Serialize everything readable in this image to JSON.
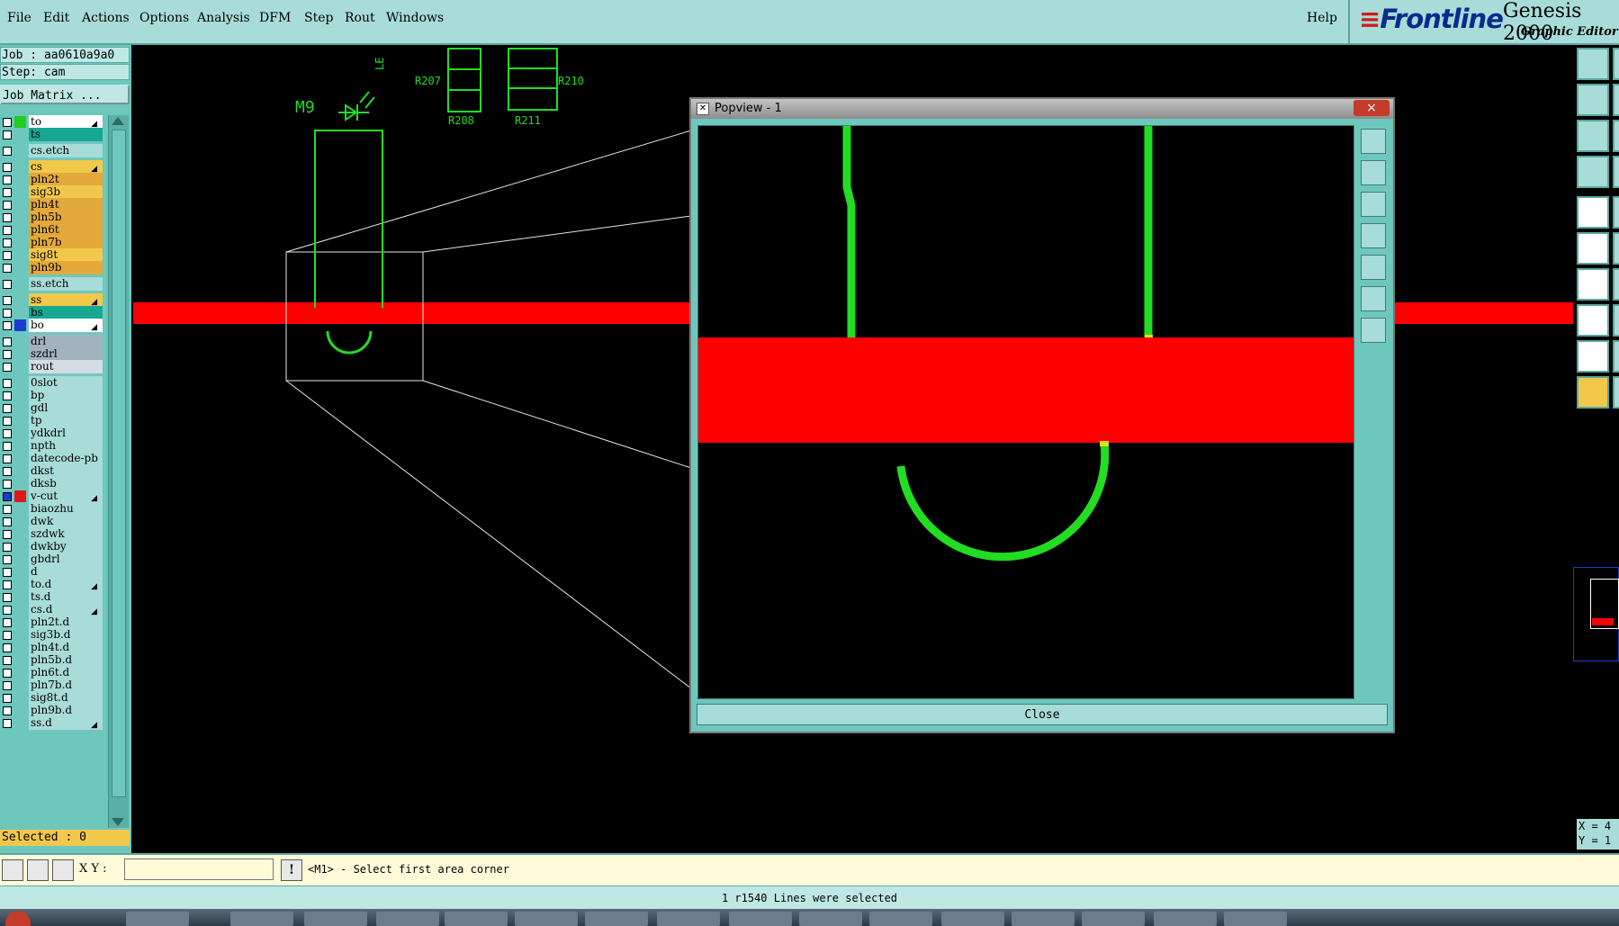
{
  "menu": {
    "items": [
      "File",
      "Edit",
      "Actions",
      "Options",
      "Analysis",
      "DFM",
      "Step",
      "Rout",
      "Windows"
    ],
    "help": "Help"
  },
  "brand": {
    "logo": "Frontline",
    "product": "Genesis 2000",
    "subtitle": "Graphic Editor"
  },
  "job": {
    "job_line": "Job : aa0610a9a0",
    "step_line": "Step: cam",
    "matrix_button": "Job Matrix ..."
  },
  "layers": [
    {
      "name": "to",
      "bg": "#ffffff",
      "swatch": "#22cc22",
      "arrow": true
    },
    {
      "name": "ts",
      "bg": "#16a892",
      "swatch": "",
      "arrow": false
    },
    {
      "name": "cs.etch",
      "bg": "#a8dcd8",
      "swatch": "",
      "arrow": false
    },
    {
      "name": "cs",
      "bg": "#f2c84a",
      "swatch": "",
      "arrow": true
    },
    {
      "name": "pln2t",
      "bg": "#e3a93a",
      "swatch": "",
      "arrow": false
    },
    {
      "name": "sig3b",
      "bg": "#f2c84a",
      "swatch": "",
      "arrow": false
    },
    {
      "name": "pln4t",
      "bg": "#e3a93a",
      "swatch": "",
      "arrow": false
    },
    {
      "name": "pln5b",
      "bg": "#e3a93a",
      "swatch": "",
      "arrow": false
    },
    {
      "name": "pln6t",
      "bg": "#e3a93a",
      "swatch": "",
      "arrow": false
    },
    {
      "name": "pln7b",
      "bg": "#e3a93a",
      "swatch": "",
      "arrow": false
    },
    {
      "name": "sig8t",
      "bg": "#f2c84a",
      "swatch": "",
      "arrow": false
    },
    {
      "name": "pln9b",
      "bg": "#e3a93a",
      "swatch": "",
      "arrow": false
    },
    {
      "name": "ss.etch",
      "bg": "#a8dcd8",
      "swatch": "",
      "arrow": false
    },
    {
      "name": "ss",
      "bg": "#f2c84a",
      "swatch": "",
      "arrow": true
    },
    {
      "name": "bs",
      "bg": "#16a892",
      "swatch": "",
      "arrow": false
    },
    {
      "name": "bo",
      "bg": "#ffffff",
      "swatch": "#1a3ccf",
      "arrow": true
    },
    {
      "name": "drl",
      "bg": "#a3b3bd",
      "swatch": "",
      "arrow": false
    },
    {
      "name": "szdrl",
      "bg": "#a3b3bd",
      "swatch": "",
      "arrow": false
    },
    {
      "name": "rout",
      "bg": "#d6dde2",
      "swatch": "",
      "arrow": false
    },
    {
      "name": "0slot",
      "bg": "#a8dcd8",
      "swatch": "",
      "arrow": false
    },
    {
      "name": "bp",
      "bg": "#a8dcd8",
      "swatch": "",
      "arrow": false
    },
    {
      "name": "gdl",
      "bg": "#a8dcd8",
      "swatch": "",
      "arrow": false
    },
    {
      "name": "tp",
      "bg": "#a8dcd8",
      "swatch": "",
      "arrow": false
    },
    {
      "name": "ydkdrl",
      "bg": "#a8dcd8",
      "swatch": "",
      "arrow": false
    },
    {
      "name": "npth",
      "bg": "#a8dcd8",
      "swatch": "",
      "arrow": false
    },
    {
      "name": "datecode-pb",
      "bg": "#a8dcd8",
      "swatch": "",
      "arrow": false
    },
    {
      "name": "dkst",
      "bg": "#a8dcd8",
      "swatch": "",
      "arrow": false
    },
    {
      "name": "dksb",
      "bg": "#a8dcd8",
      "swatch": "",
      "arrow": false
    },
    {
      "name": "v-cut",
      "bg": "#a8dcd8",
      "swatch": "#e01818",
      "arrow": true,
      "active": true
    },
    {
      "name": "biaozhu",
      "bg": "#a8dcd8",
      "swatch": "",
      "arrow": false
    },
    {
      "name": "dwk",
      "bg": "#a8dcd8",
      "swatch": "",
      "arrow": false
    },
    {
      "name": "szdwk",
      "bg": "#a8dcd8",
      "swatch": "",
      "arrow": false
    },
    {
      "name": "dwkby",
      "bg": "#a8dcd8",
      "swatch": "",
      "arrow": false
    },
    {
      "name": "gbdrl",
      "bg": "#a8dcd8",
      "swatch": "",
      "arrow": false
    },
    {
      "name": "d",
      "bg": "#a8dcd8",
      "swatch": "",
      "arrow": false
    },
    {
      "name": "to.d",
      "bg": "#a8dcd8",
      "swatch": "",
      "arrow": true
    },
    {
      "name": "ts.d",
      "bg": "#a8dcd8",
      "swatch": "",
      "arrow": false
    },
    {
      "name": "cs.d",
      "bg": "#a8dcd8",
      "swatch": "",
      "arrow": true
    },
    {
      "name": "pln2t.d",
      "bg": "#a8dcd8",
      "swatch": "",
      "arrow": false
    },
    {
      "name": "sig3b.d",
      "bg": "#a8dcd8",
      "swatch": "",
      "arrow": false
    },
    {
      "name": "pln4t.d",
      "bg": "#a8dcd8",
      "swatch": "",
      "arrow": false
    },
    {
      "name": "pln5b.d",
      "bg": "#a8dcd8",
      "swatch": "",
      "arrow": false
    },
    {
      "name": "pln6t.d",
      "bg": "#a8dcd8",
      "swatch": "",
      "arrow": false
    },
    {
      "name": "pln7b.d",
      "bg": "#a8dcd8",
      "swatch": "",
      "arrow": false
    },
    {
      "name": "sig8t.d",
      "bg": "#a8dcd8",
      "swatch": "",
      "arrow": false
    },
    {
      "name": "pln9b.d",
      "bg": "#a8dcd8",
      "swatch": "",
      "arrow": false
    },
    {
      "name": "ss.d",
      "bg": "#a8dcd8",
      "swatch": "",
      "arrow": true
    }
  ],
  "selected": "Selected : 0",
  "canvas": {
    "labels": [
      "M9",
      "R207",
      "R208",
      "R210",
      "R211",
      "LE"
    ],
    "feature_color": "#22dd22",
    "vcut_color": "#ff0000"
  },
  "popview": {
    "title": "Popview - 1",
    "close_x": "×",
    "close_button": "Close"
  },
  "command": {
    "xy_label": "X Y :",
    "xy_value": "",
    "prompt": "<M1> - Select first area corner"
  },
  "status": "1 r1540 Lines were selected",
  "coords": {
    "x": "X = 4",
    "y": "Y = 1"
  }
}
